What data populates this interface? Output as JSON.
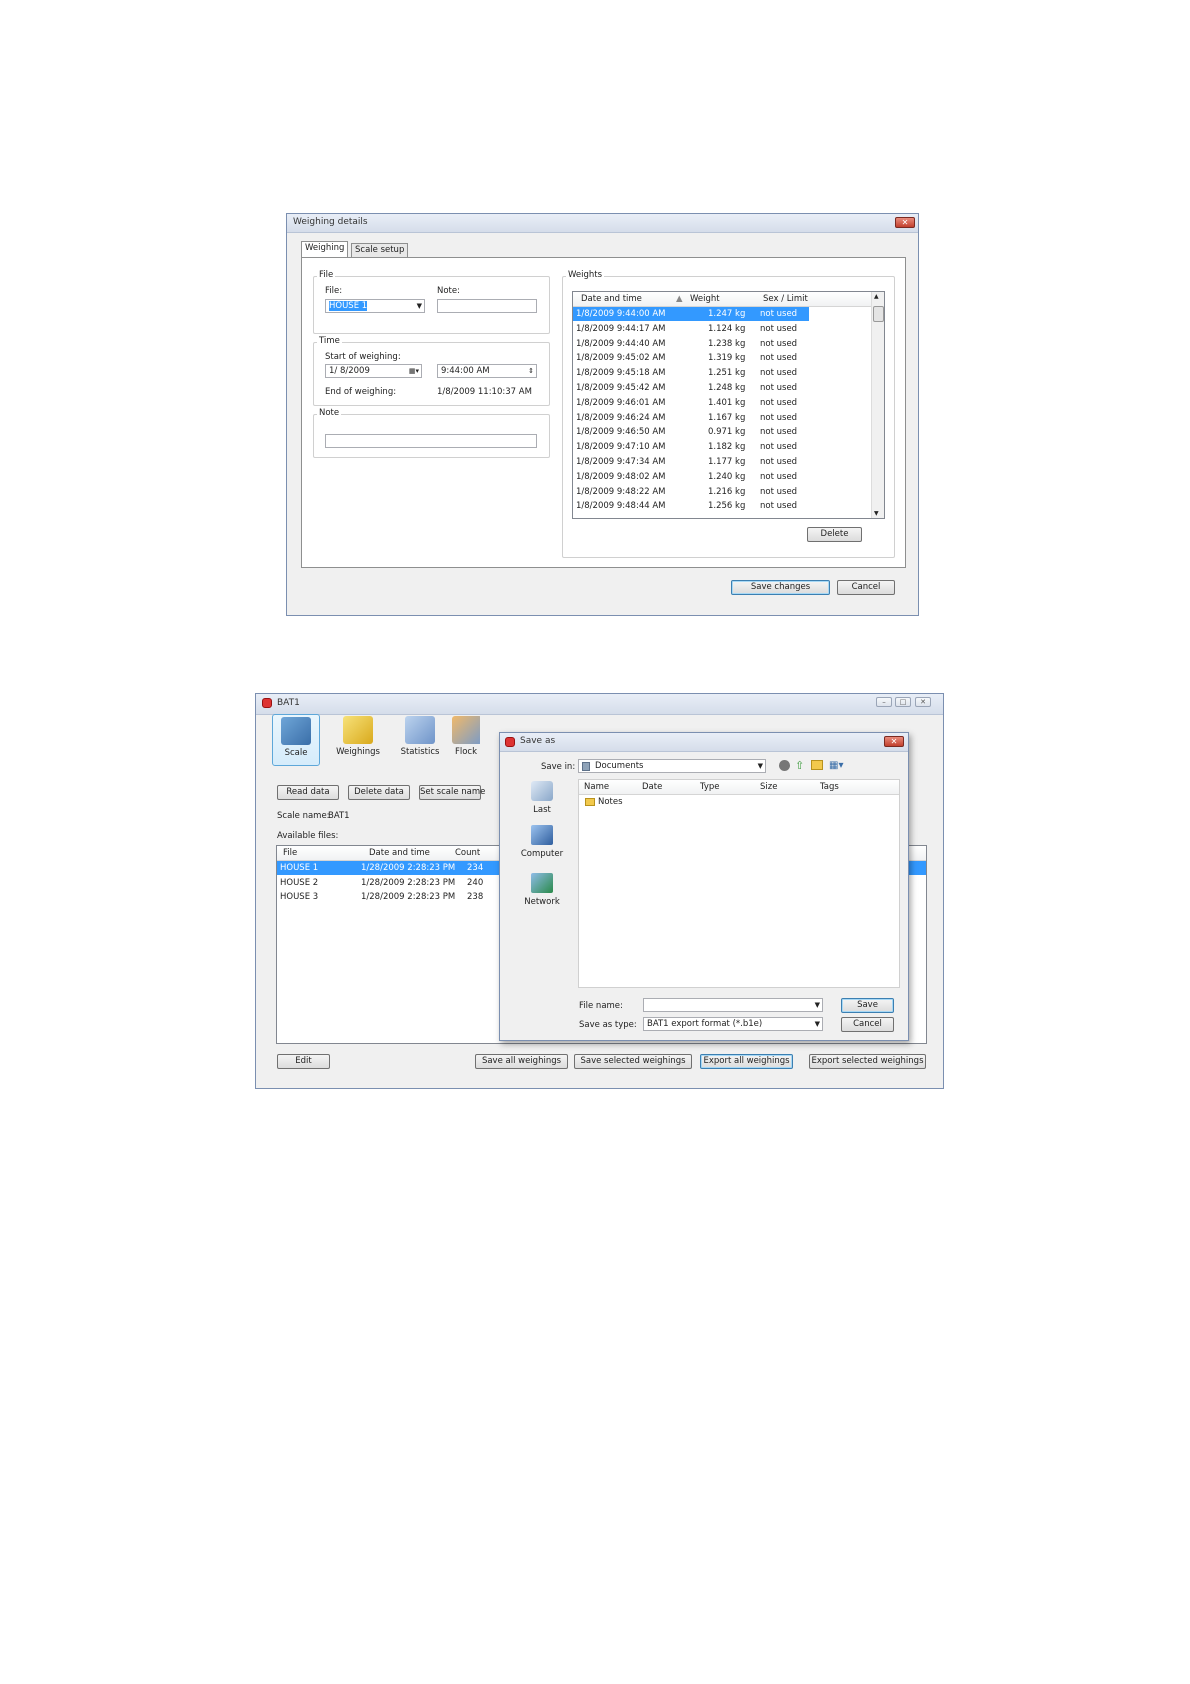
{
  "weighing_details": {
    "title": "Weighing details",
    "tabs": [
      "Weighing",
      "Scale setup"
    ],
    "file_group": {
      "label": "File",
      "file_label": "File:",
      "file_value": "HOUSE 1",
      "note_label": "Note:",
      "note_value": ""
    },
    "time_group": {
      "label": "Time",
      "start_label": "Start of weighing:",
      "start_date": "1/ 8/2009",
      "start_time": "9:44:00 AM",
      "end_label": "End of weighing:",
      "end_value": "1/8/2009 11:10:37 AM"
    },
    "note_group": {
      "label": "Note",
      "value": ""
    },
    "weights_group": {
      "label": "Weights",
      "columns": [
        "Date and time",
        "Weight",
        "Sex / Limit"
      ],
      "rows": [
        {
          "dt": "1/8/2009 9:44:00 AM",
          "w": "1.247 kg",
          "s": "not used"
        },
        {
          "dt": "1/8/2009 9:44:17 AM",
          "w": "1.124 kg",
          "s": "not used"
        },
        {
          "dt": "1/8/2009 9:44:40 AM",
          "w": "1.238 kg",
          "s": "not used"
        },
        {
          "dt": "1/8/2009 9:45:02 AM",
          "w": "1.319 kg",
          "s": "not used"
        },
        {
          "dt": "1/8/2009 9:45:18 AM",
          "w": "1.251 kg",
          "s": "not used"
        },
        {
          "dt": "1/8/2009 9:45:42 AM",
          "w": "1.248 kg",
          "s": "not used"
        },
        {
          "dt": "1/8/2009 9:46:01 AM",
          "w": "1.401 kg",
          "s": "not used"
        },
        {
          "dt": "1/8/2009 9:46:24 AM",
          "w": "1.167 kg",
          "s": "not used"
        },
        {
          "dt": "1/8/2009 9:46:50 AM",
          "w": "0.971 kg",
          "s": "not used"
        },
        {
          "dt": "1/8/2009 9:47:10 AM",
          "w": "1.182 kg",
          "s": "not used"
        },
        {
          "dt": "1/8/2009 9:47:34 AM",
          "w": "1.177 kg",
          "s": "not used"
        },
        {
          "dt": "1/8/2009 9:48:02 AM",
          "w": "1.240 kg",
          "s": "not used"
        },
        {
          "dt": "1/8/2009 9:48:22 AM",
          "w": "1.216 kg",
          "s": "not used"
        },
        {
          "dt": "1/8/2009 9:48:44 AM",
          "w": "1.256 kg",
          "s": "not used"
        }
      ],
      "delete_label": "Delete"
    },
    "save_label": "Save changes",
    "cancel_label": "Cancel"
  },
  "bat1": {
    "title": "BAT1",
    "ribbon": [
      "Scale",
      "Weighings",
      "Statistics",
      "Flock"
    ],
    "actions": [
      "Read data",
      "Delete data",
      "Set scale name"
    ],
    "scale_name_label": "Scale name:",
    "scale_name_value": "BAT1",
    "available_files_label": "Available files:",
    "columns": [
      "File",
      "Date and time",
      "Count"
    ],
    "files": [
      {
        "file": "HOUSE 1",
        "dt": "1/28/2009 2:28:23 PM",
        "count": "234"
      },
      {
        "file": "HOUSE 2",
        "dt": "1/28/2009 2:28:23 PM",
        "count": "240"
      },
      {
        "file": "HOUSE 3",
        "dt": "1/28/2009 2:28:23 PM",
        "count": "238"
      }
    ],
    "bottom_buttons": [
      "Edit",
      "Save all weighings",
      "Save selected weighings",
      "Export all weighings",
      "Export selected weighings"
    ]
  },
  "save_as": {
    "title": "Save as",
    "save_in_label": "Save in:",
    "save_in_value": "Documents",
    "places": [
      "Last",
      "Computer",
      "Network"
    ],
    "columns": [
      "Name",
      "Date",
      "Type",
      "Size",
      "Tags"
    ],
    "items": [
      "Notes"
    ],
    "file_name_label": "File name:",
    "file_name_value": "",
    "save_type_label": "Save as type:",
    "save_type_value": "BAT1 export format (*.b1e)",
    "save_label": "Save",
    "cancel_label": "Cancel"
  },
  "colors": {
    "selection": "#3399ff",
    "accent": "#3c7fb1",
    "close": "#c2402e"
  }
}
